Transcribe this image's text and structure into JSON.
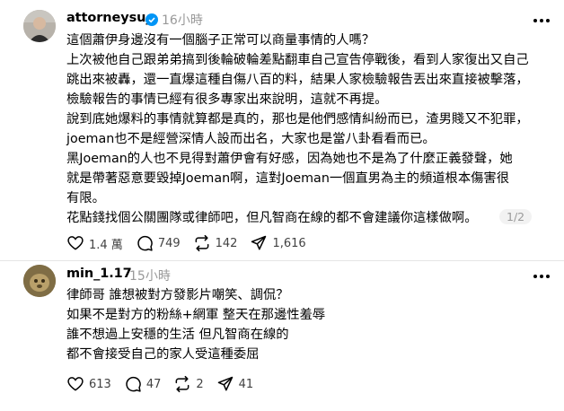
{
  "post1": {
    "username": "attorneysu_",
    "verified": true,
    "time": "16小時",
    "lines": [
      "這個蕭伊身邊沒有一個腦子正常可以商量事情的人嗎？",
      "上次被他自己跟弟弟搞到後輪破輪差點翻車自己宣告停戰後，看到人家復出又自己",
      "跳出來被轟，還一直爆這種自傷八百的料，結果人家檢驗報告丟出來直接被擊落，",
      "檢驗報告的事情已經有很多專家出來說明，這就不再提。",
      "說到底她爆料的事情就算都是真的，那也是他們感情糾紛而已，渣男賤又不犯罪，",
      "joeman也不是經營深情人設而出名，大家也是當八卦看看而已。",
      "黑Joeman的人也不見得對蕭伊會有好感，因為她也不是為了什麼正義發聲，她",
      "就是帶著惡意要毀掉Joeman啊，這對Joeman一個直男為主的頻道根本傷害很",
      "有限。",
      "花點錢找個公關團隊或律師吧，但凡智商在線的都不會建議你這樣做啊。"
    ],
    "pager": "1/2",
    "likes": "1.4 萬",
    "comments": "749",
    "reposts": "142",
    "shares": "1,616"
  },
  "post2": {
    "username": "min_1.17",
    "time": "15小時",
    "lines": [
      "律師哥 誰想被對方發影片嘲笑、調侃？",
      "如果不是對方的粉絲+網軍 整天在那邊性羞辱",
      "誰不想過上安穩的生活 但凡智商在線的",
      "都不會接受自己的家人受這種委屈"
    ],
    "likes": "613",
    "comments": "47",
    "reposts": "2",
    "shares": "41"
  },
  "icons": [
    "verified-badge-icon",
    "more-icon",
    "heart-icon",
    "comment-icon",
    "repost-icon",
    "share-icon"
  ],
  "colors": {
    "verified": "#0095f6",
    "secondary_text": "#999999",
    "action_text": "#424242"
  }
}
